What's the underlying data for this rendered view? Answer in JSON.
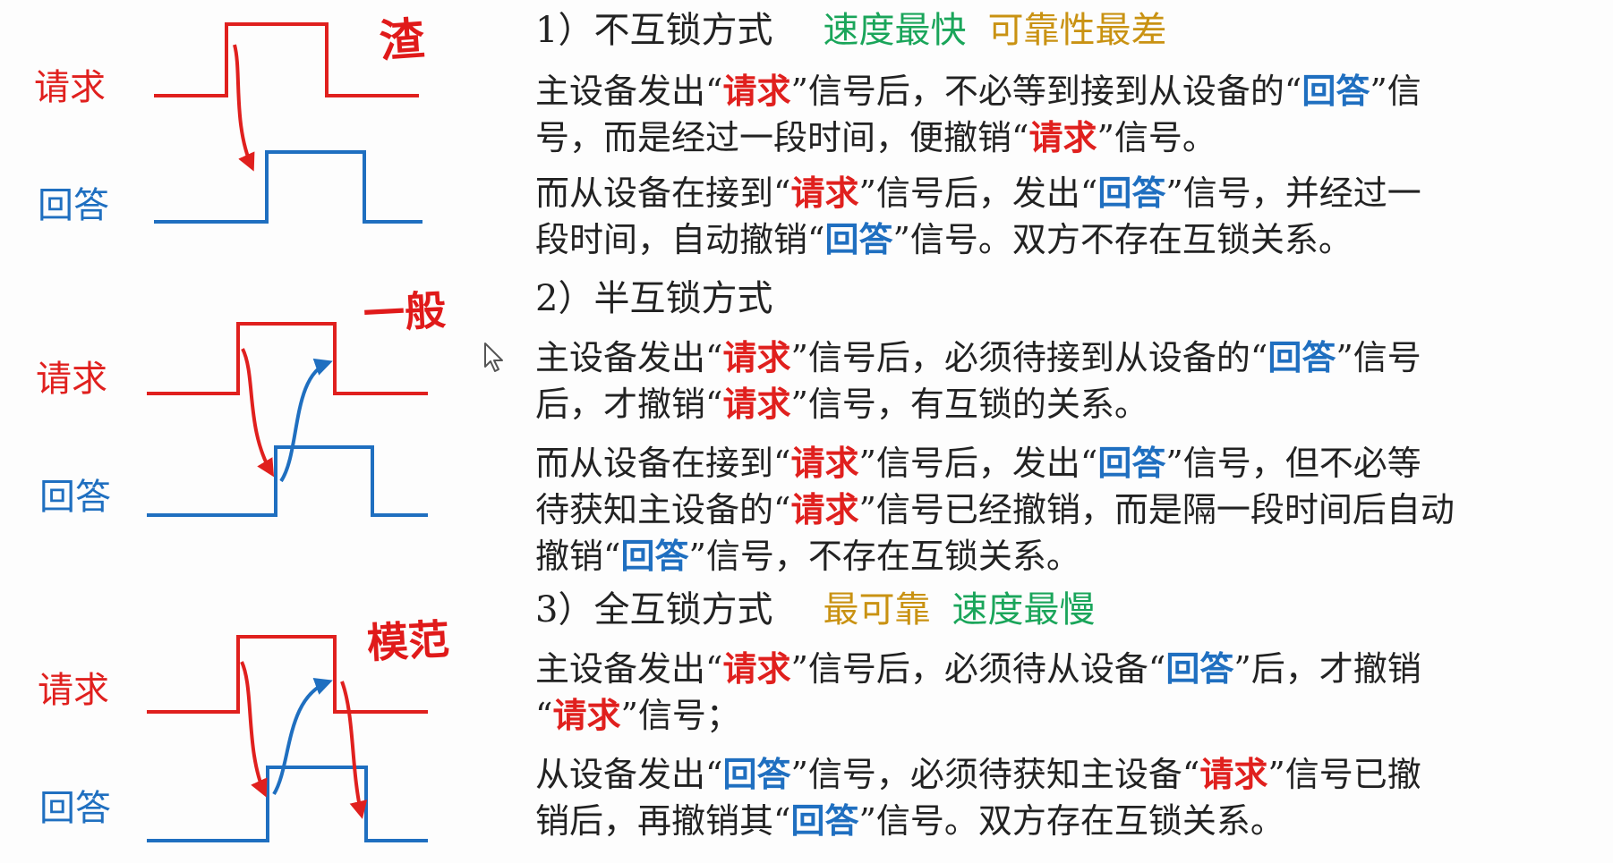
{
  "colors": {
    "request": "#e0201e",
    "answer": "#1f6fc0",
    "speed_tag": "#1aa55a",
    "reliability_tag": "#c99212",
    "text": "#222222"
  },
  "labels": {
    "request": "请求",
    "answer": "回答"
  },
  "handwritten_notes": [
    "渣",
    "一般",
    "模范"
  ],
  "sections": [
    {
      "heading": "1）不互锁方式",
      "tags": [
        {
          "text": "速度最快",
          "style": "green"
        },
        {
          "text": "可靠性最差",
          "style": "gold"
        }
      ],
      "paragraphs": [
        [
          [
            "t",
            "主设备发出“"
          ],
          [
            "r",
            "请求"
          ],
          [
            "t",
            "”信号后，不必等到接到从设备的“"
          ],
          [
            "b",
            "回答"
          ],
          [
            "t",
            "”信"
          ],
          [
            "br",
            ""
          ],
          [
            "t",
            "号，而是经过一段时间，便撤销“"
          ],
          [
            "r",
            "请求"
          ],
          [
            "t",
            "”信号。"
          ]
        ],
        [
          [
            "t",
            "而从设备在接到“"
          ],
          [
            "r",
            "请求"
          ],
          [
            "t",
            "”信号后，发出“"
          ],
          [
            "b",
            "回答"
          ],
          [
            "t",
            "”信号，并经过一"
          ],
          [
            "br",
            ""
          ],
          [
            "t",
            "段时间，自动撤销“"
          ],
          [
            "b",
            "回答"
          ],
          [
            "t",
            "”信号。双方不存在互锁关系。"
          ]
        ]
      ]
    },
    {
      "heading": "2）半互锁方式",
      "tags": [],
      "paragraphs": [
        [
          [
            "t",
            "主设备发出“"
          ],
          [
            "r",
            "请求"
          ],
          [
            "t",
            "”信号后，必须待接到从设备的“"
          ],
          [
            "b",
            "回答"
          ],
          [
            "t",
            "”信号"
          ],
          [
            "br",
            ""
          ],
          [
            "t",
            "后，才撤销“"
          ],
          [
            "r",
            "请求"
          ],
          [
            "t",
            "”信号，有互锁的关系。"
          ]
        ],
        [
          [
            "t",
            "而从设备在接到“"
          ],
          [
            "r",
            "请求"
          ],
          [
            "t",
            "”信号后，发出“"
          ],
          [
            "b",
            "回答"
          ],
          [
            "t",
            "”信号，但不必等"
          ],
          [
            "br",
            ""
          ],
          [
            "t",
            "待获知主设备的“"
          ],
          [
            "r",
            "请求"
          ],
          [
            "t",
            "”信号已经撤销，而是隔一段时间后自动"
          ],
          [
            "br",
            ""
          ],
          [
            "t",
            "撤销“"
          ],
          [
            "b",
            "回答"
          ],
          [
            "t",
            "”信号，不存在互锁关系。"
          ]
        ]
      ]
    },
    {
      "heading": "3）全互锁方式",
      "tags": [
        {
          "text": "最可靠",
          "style": "gold"
        },
        {
          "text": "速度最慢",
          "style": "green"
        }
      ],
      "paragraphs": [
        [
          [
            "t",
            "主设备发出“"
          ],
          [
            "r",
            "请求"
          ],
          [
            "t",
            "”信号后，必须待从设备“"
          ],
          [
            "b",
            "回答"
          ],
          [
            "t",
            "”后，才撤销"
          ],
          [
            "br",
            ""
          ],
          [
            "t",
            "“"
          ],
          [
            "r",
            "请求"
          ],
          [
            "t",
            "”信号；"
          ]
        ],
        [
          [
            "t",
            "从设备发出“"
          ],
          [
            "b",
            "回答"
          ],
          [
            "t",
            "”信号，必须待获知主设备“"
          ],
          [
            "r",
            "请求"
          ],
          [
            "t",
            "”信号已撤"
          ],
          [
            "br",
            ""
          ],
          [
            "t",
            "销后，再撤销其“"
          ],
          [
            "b",
            "回答"
          ],
          [
            "t",
            "”信号。双方存在互锁关系。"
          ]
        ]
      ]
    }
  ]
}
